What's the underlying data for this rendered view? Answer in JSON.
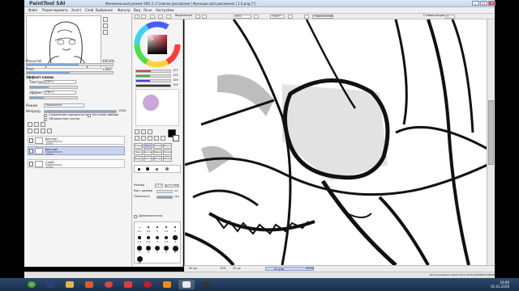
{
  "window": {
    "logo": "PaintTool SAI",
    "title": "Минимальный режим ЭКО 2 | Главное рисование | Функции для рисования | 1.6.png [*]",
    "min": "_",
    "max": "□",
    "close": "✕"
  },
  "menu": [
    "Файл",
    "Редактировать",
    "Холст",
    "Слой",
    "Выбрание",
    "Фильтр",
    "Вид",
    "Окно",
    "Настройки"
  ],
  "toolbar": {
    "selection_label": "Выделение",
    "zoom": "50%",
    "angle": "+000°",
    "mode": "Нормальный",
    "stab_label": "Стабилизация",
    "stab_value": "3"
  },
  "navigator": {
    "zoom_label": "Масштаб",
    "zoom_value": "100.0%",
    "angle_label": "Угол",
    "angle_value": "+000°"
  },
  "paper": {
    "header": "Эффект канвы",
    "texture_label": "Текстура",
    "texture_value": "[Нет]",
    "effect_label": "Эффект",
    "effect_value": "[Нет]"
  },
  "layer_props": {
    "mode_label": "Режим",
    "mode_value": "Нормально",
    "opacity_label": "Непрозр.",
    "opacity_value": "100%",
    "preserve_label": "Сохранение прозрачности",
    "clip_label": "Обтравочная группа",
    "sel_source_label": "Источник выбора"
  },
  "layers": [
    {
      "name": "Вектор1",
      "mode": "Нормально",
      "opacity": "100%"
    },
    {
      "name": "Вектор2",
      "mode": "Нормально",
      "opacity": "100%"
    },
    {
      "name": "Слой1",
      "mode": "Нормально",
      "opacity": "100%"
    }
  ],
  "color": {
    "r_value": "107",
    "g_value": "100",
    "b_value": "100",
    "a_value": "100",
    "swatch": "#c9a8d8"
  },
  "tools": {
    "row1": [
      "Поворот",
      "Рука",
      "Пипетка",
      "Ластик"
    ],
    "row2": [
      "Перо",
      "Кисть",
      "Маркер",
      "Заливка"
    ],
    "row3": [
      "Выделение",
      "Лассо",
      "Волш.",
      "Линия"
    ]
  },
  "brush": {
    "mode_label": "Размер",
    "size_value": "1.5",
    "size_mult": "x 1.0",
    "min_size_label": "Мин. размер",
    "min_size_value": "0%",
    "density_label": "Плотность",
    "density_value": "100",
    "extra_label": "Дополнительно",
    "sizes": [
      "0.7",
      "0.8",
      "1",
      "1.5",
      "2",
      "2.3",
      "2.6",
      "3",
      "3.5",
      "4",
      "5",
      "6",
      "7",
      "8",
      "9",
      "10"
    ]
  },
  "status": {
    "nav1": "50 px",
    "nav2": "70%",
    "nav3": "22 px",
    "file": "22.png",
    "zoom": "100%",
    "memory": "Использование памяти 52% (ЭСК) Ж/МУФ/ОСЖ/ПРБ"
  },
  "clock": {
    "time": "19:06",
    "date": "01.01.2016"
  },
  "colors": {
    "accent": "#7da7d9",
    "selected_layer": "#c8d4f2",
    "taskbar": "#1a2f4a"
  }
}
